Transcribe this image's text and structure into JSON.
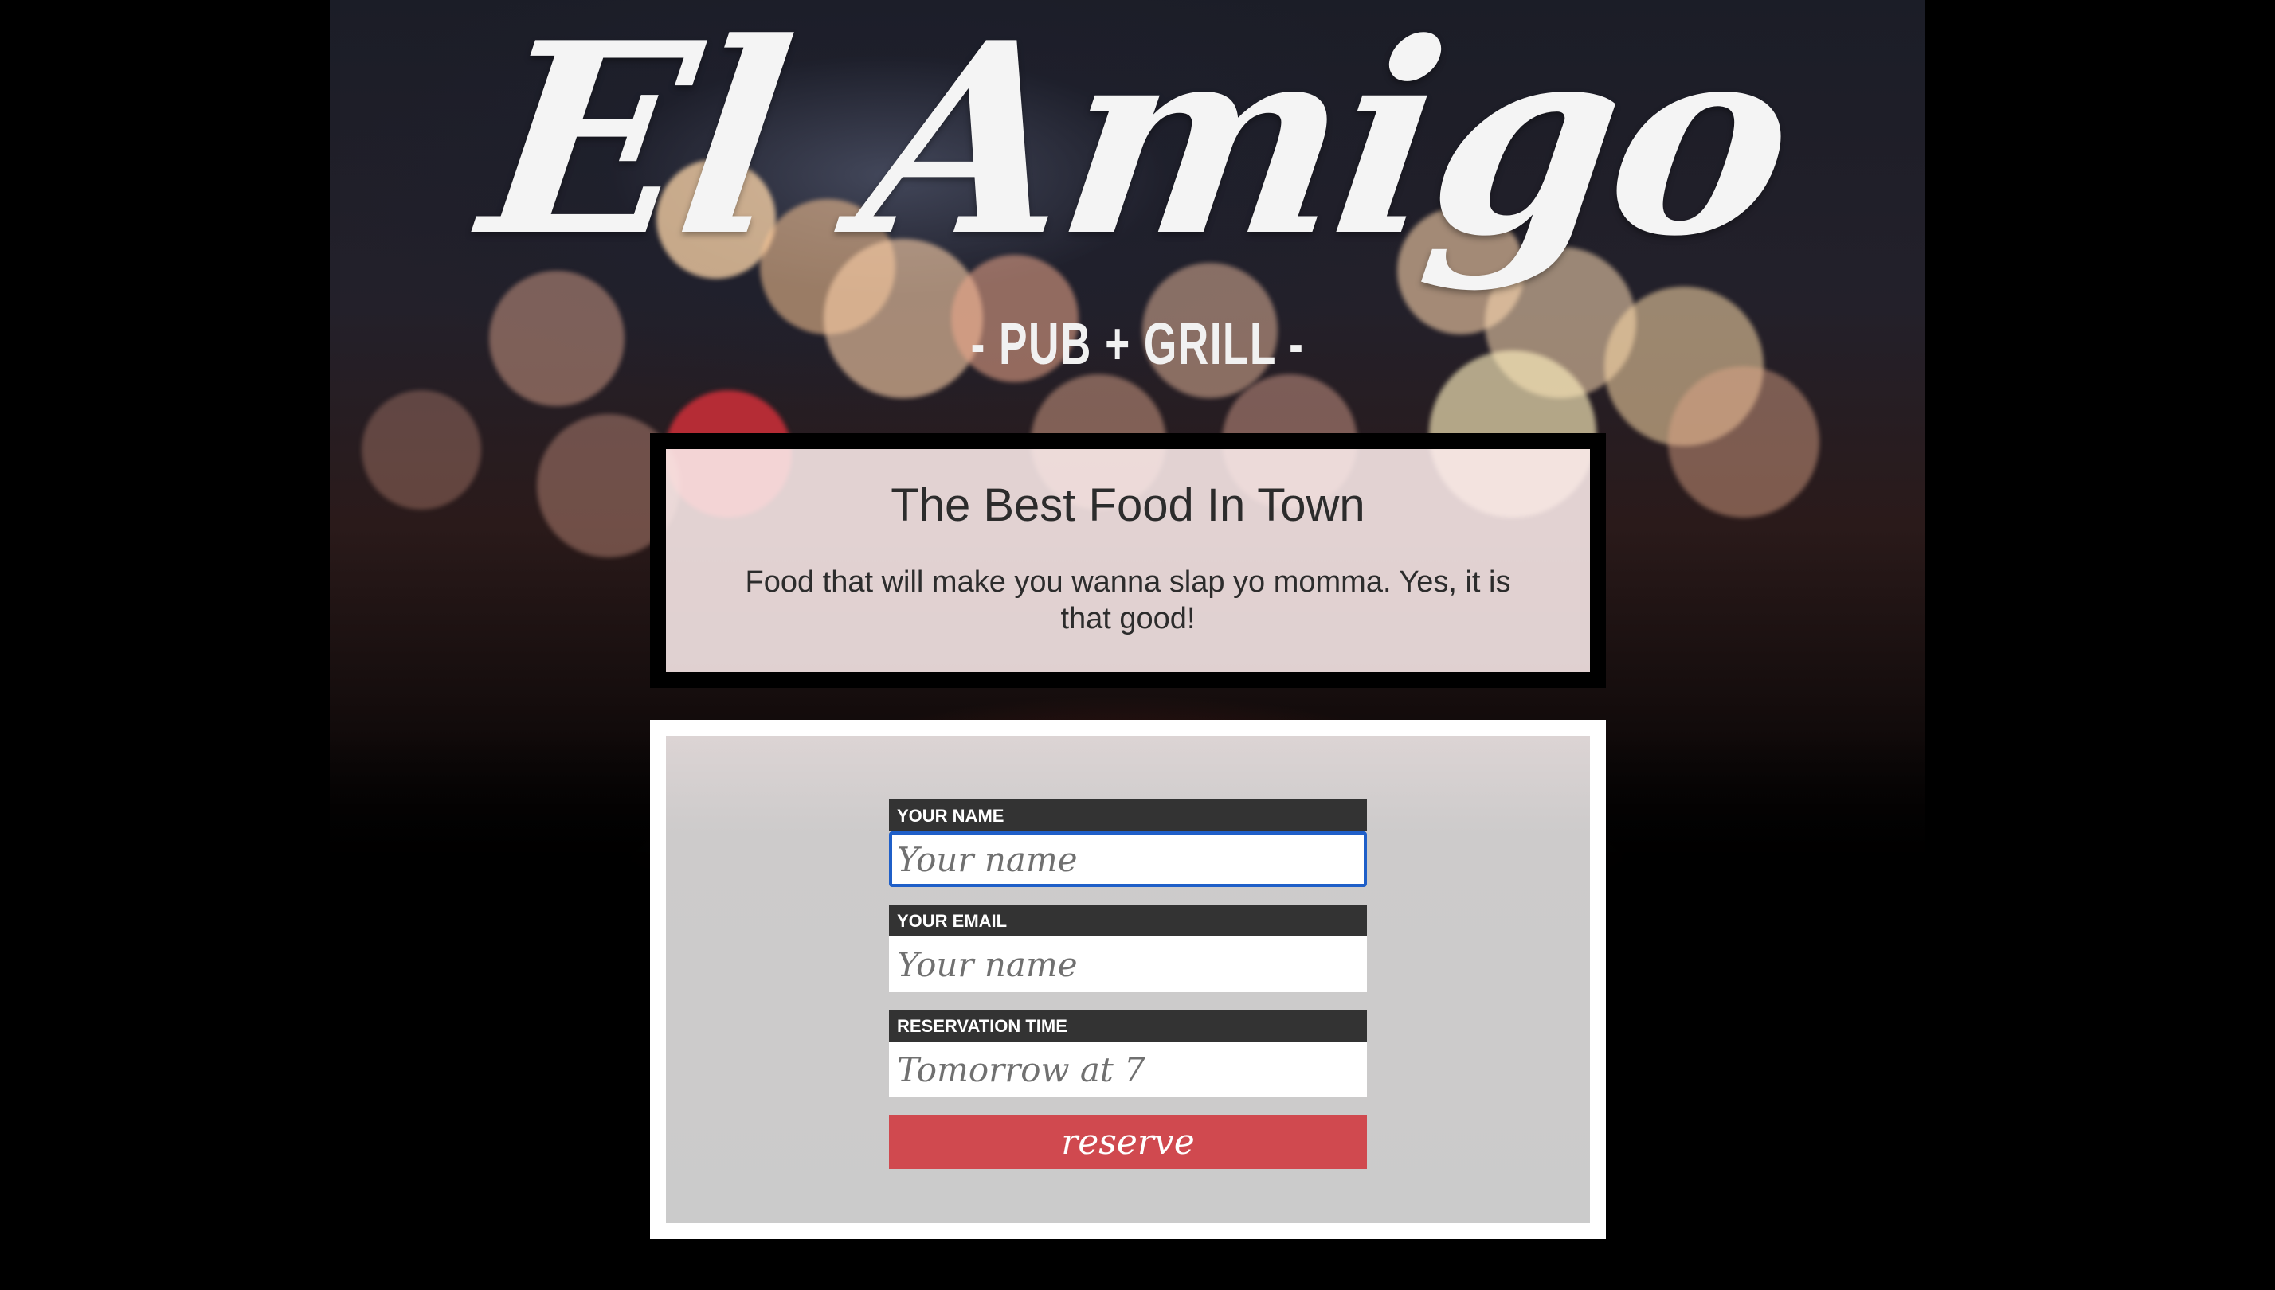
{
  "logo": {
    "name": "El Amigo",
    "tagline": "- PUB + GRILL -"
  },
  "intro": {
    "heading": "The Best Food In Town",
    "text": "Food that will make you wanna slap yo momma. Yes, it is that good!"
  },
  "form": {
    "name_label": "YOUR NAME",
    "name_placeholder": "Your name",
    "email_label": "YOUR EMAIL",
    "email_placeholder": "Your name",
    "time_label": "RESERVATION TIME",
    "time_placeholder": "Tomorrow at 7",
    "submit_label": "reserve"
  },
  "colors": {
    "accent": "#d0494f",
    "label_bg": "#333333",
    "focus_ring": "#1f5fc8"
  }
}
